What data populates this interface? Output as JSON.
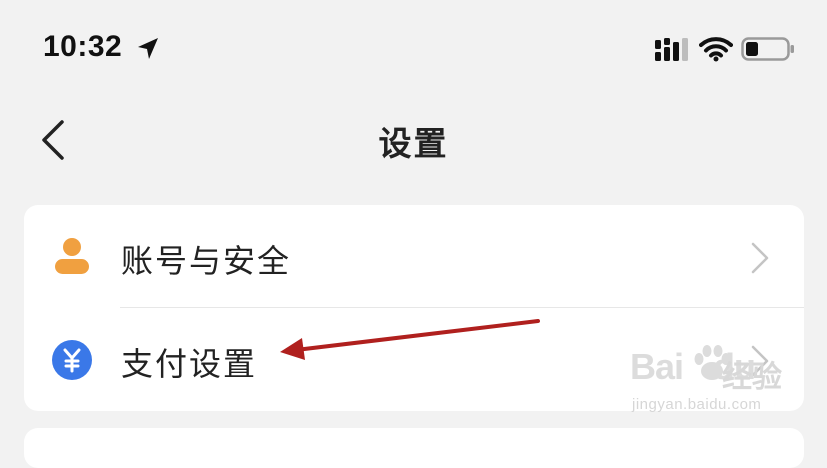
{
  "status_bar": {
    "time": "10:32",
    "icons": [
      "location-arrow-icon",
      "signal-icon",
      "wifi-icon",
      "battery-icon"
    ]
  },
  "nav": {
    "title": "设置",
    "back_icon": "chevron-left-icon"
  },
  "settings": {
    "items": [
      {
        "label": "账号与安全",
        "icon": "user-icon",
        "icon_color": "#f0a040"
      },
      {
        "label": "支付设置",
        "icon": "yuan-icon",
        "icon_color": "#3a78e8"
      }
    ]
  },
  "annotation": {
    "color": "#b0201e"
  },
  "watermark": {
    "brand": "Bai",
    "brand_tail": "du",
    "suffix": "经验",
    "url": "jingyan.baidu.com"
  },
  "colors": {
    "background": "#f2f2f2",
    "card": "#ffffff",
    "text": "#222222",
    "chevron": "#c4c4c4"
  }
}
